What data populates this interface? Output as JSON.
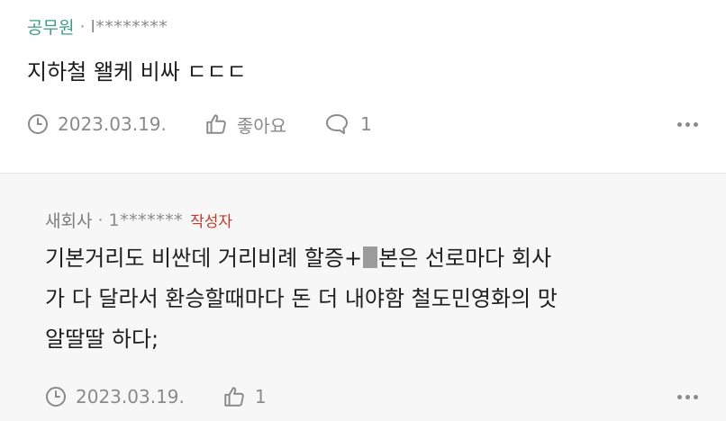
{
  "comments": [
    {
      "author": "공무원",
      "separator": "·",
      "user_id": "l********",
      "body_lines": [
        "지하철 왤케 비싸 ㄷㄷㄷ"
      ],
      "date": "2023.03.19.",
      "like_label": "좋아요",
      "reply_count": "1"
    },
    {
      "author": "새회사",
      "separator": "·",
      "user_id": "1*******",
      "writer_badge": "작성자",
      "body_lines": [
        {
          "before": "기본거리도 비싼데 거리비례 할증+",
          "after": "본은 선로마다 회사"
        },
        "가 다 달라서 환승할때마다 돈 더 내야함 철도민영화의 맛",
        "알딸딸 하다;"
      ],
      "date": "2023.03.19.",
      "like_count": "1"
    }
  ],
  "colors": {
    "author_green": "#3e9b88",
    "writer_red": "#c0392b",
    "muted_gray": "#8a8a8a",
    "reply_bg": "#f7f7f7"
  },
  "icons": [
    "clock-icon",
    "thumbs-up-icon",
    "speech-bubble-icon",
    "more-dots-icon"
  ]
}
